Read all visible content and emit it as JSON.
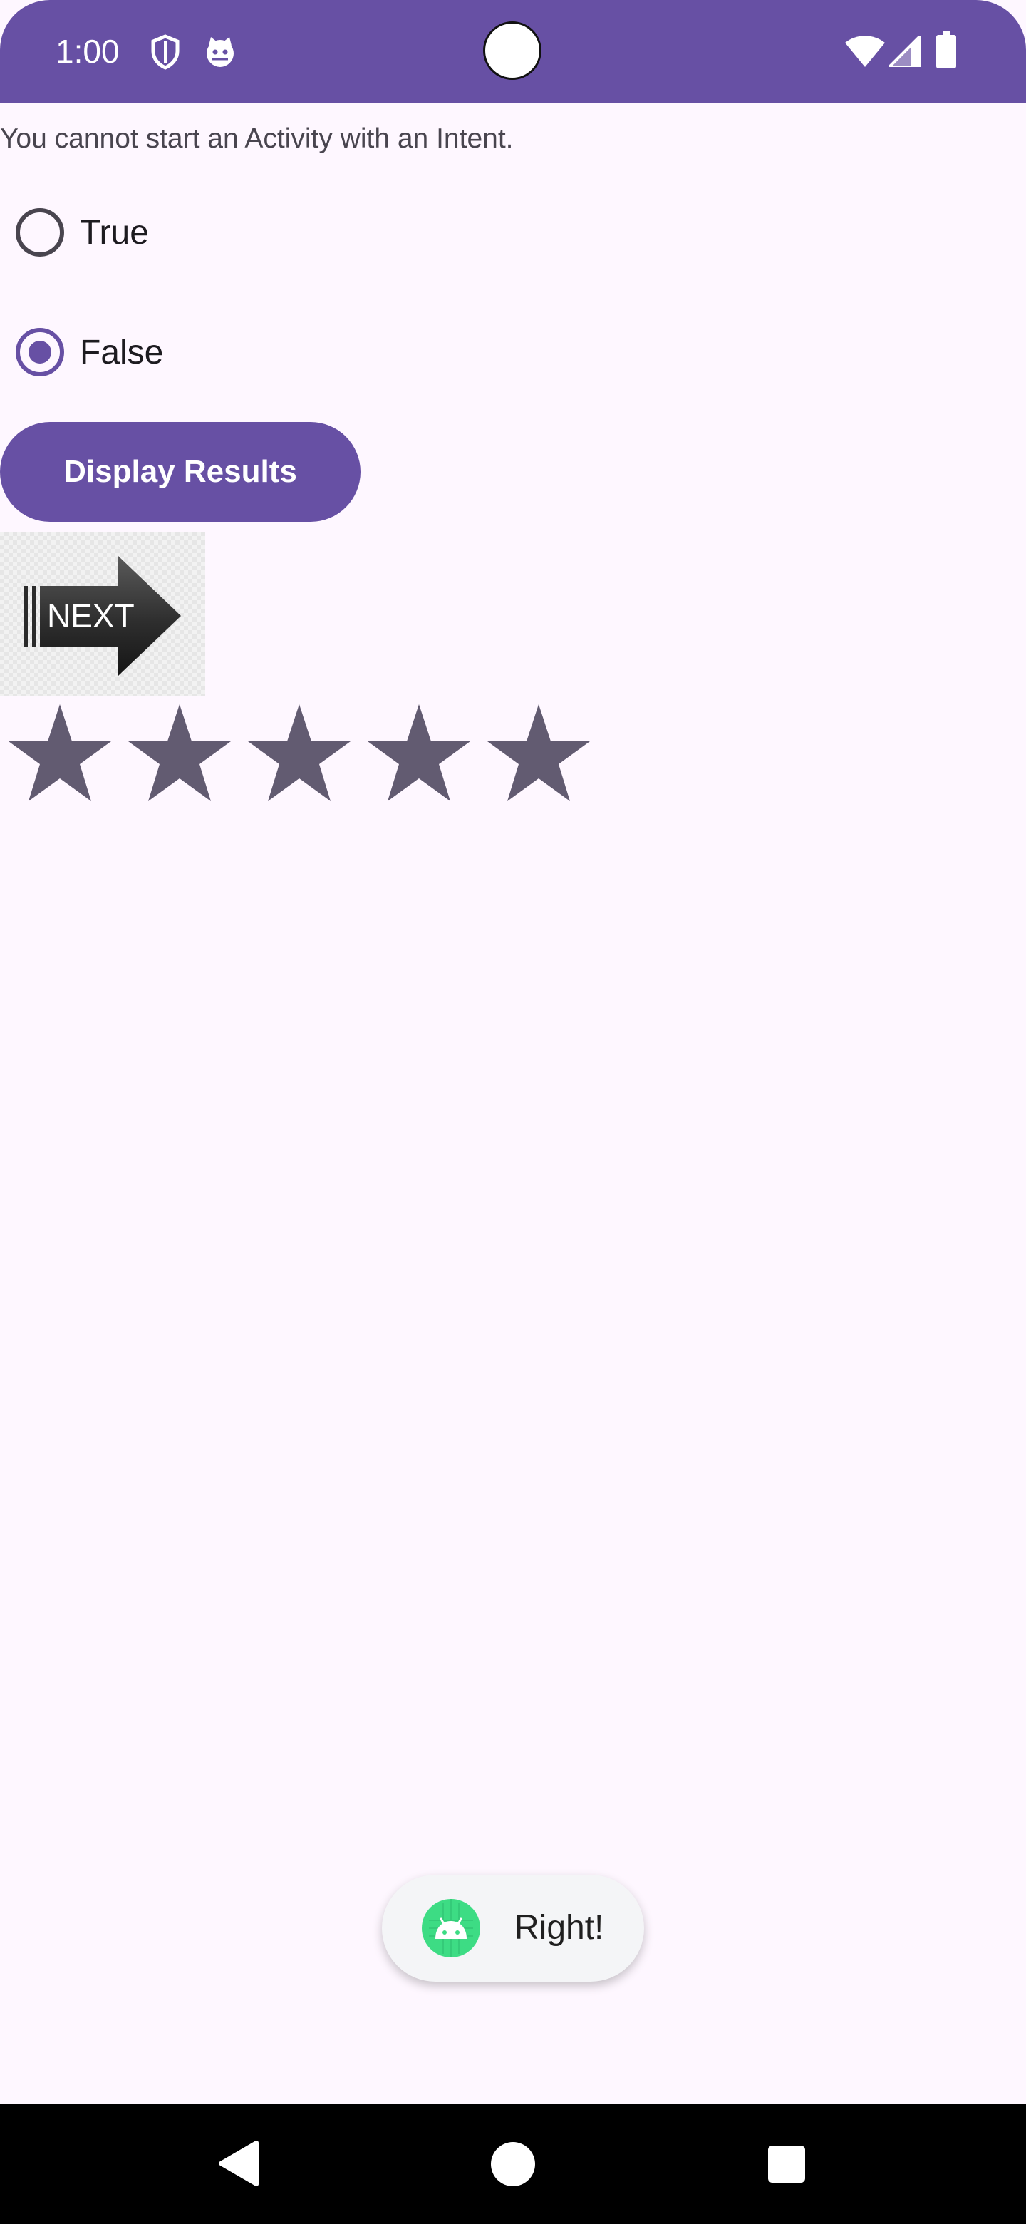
{
  "status_bar": {
    "time": "1:00",
    "background": "#6750a4",
    "icons": [
      "shield-icon",
      "cat-face-icon",
      "wifi-icon",
      "cell-signal-icon",
      "battery-icon"
    ]
  },
  "question": {
    "text": "You cannot start an Activity with an Intent."
  },
  "options": [
    {
      "label": "True",
      "selected": false
    },
    {
      "label": "False",
      "selected": true
    }
  ],
  "actions": {
    "display_results_label": "Display Results"
  },
  "next_button": {
    "text": "NEXT",
    "icon": "next-arrow-icon"
  },
  "rating": {
    "stars": 5,
    "color": "#625b71"
  },
  "toast": {
    "text": "Right!",
    "icon": "android-icon"
  },
  "nav_bar": {
    "buttons": [
      "back-icon",
      "home-icon",
      "recents-icon"
    ]
  },
  "colors": {
    "primary": "#6750a4",
    "background": "#fef7ff",
    "text": "#49454f"
  }
}
